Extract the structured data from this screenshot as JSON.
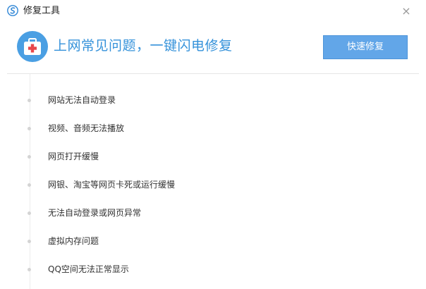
{
  "window": {
    "title": "修复工具",
    "close_glyph": "×"
  },
  "header": {
    "headline": "上网常见问题，一键闪电修复",
    "quick_fix_label": "快速修复"
  },
  "problems": [
    {
      "label": "网站无法自动登录"
    },
    {
      "label": "视频、音频无法播放"
    },
    {
      "label": "网页打开缓慢"
    },
    {
      "label": "网银、淘宝等网页卡死或运行缓慢"
    },
    {
      "label": "无法自动登录或网页异常"
    },
    {
      "label": "虚拟内存问题"
    },
    {
      "label": "QQ空间无法正常显示"
    }
  ],
  "icons": {
    "app_logo": "browser-logo-icon",
    "header_icon": "first-aid-kit-icon",
    "close": "close-icon"
  },
  "colors": {
    "accent_text": "#3592da",
    "button_bg": "#62a6e8",
    "kit_bg": "#4a9fe3",
    "kit_cross": "#e8474b"
  }
}
